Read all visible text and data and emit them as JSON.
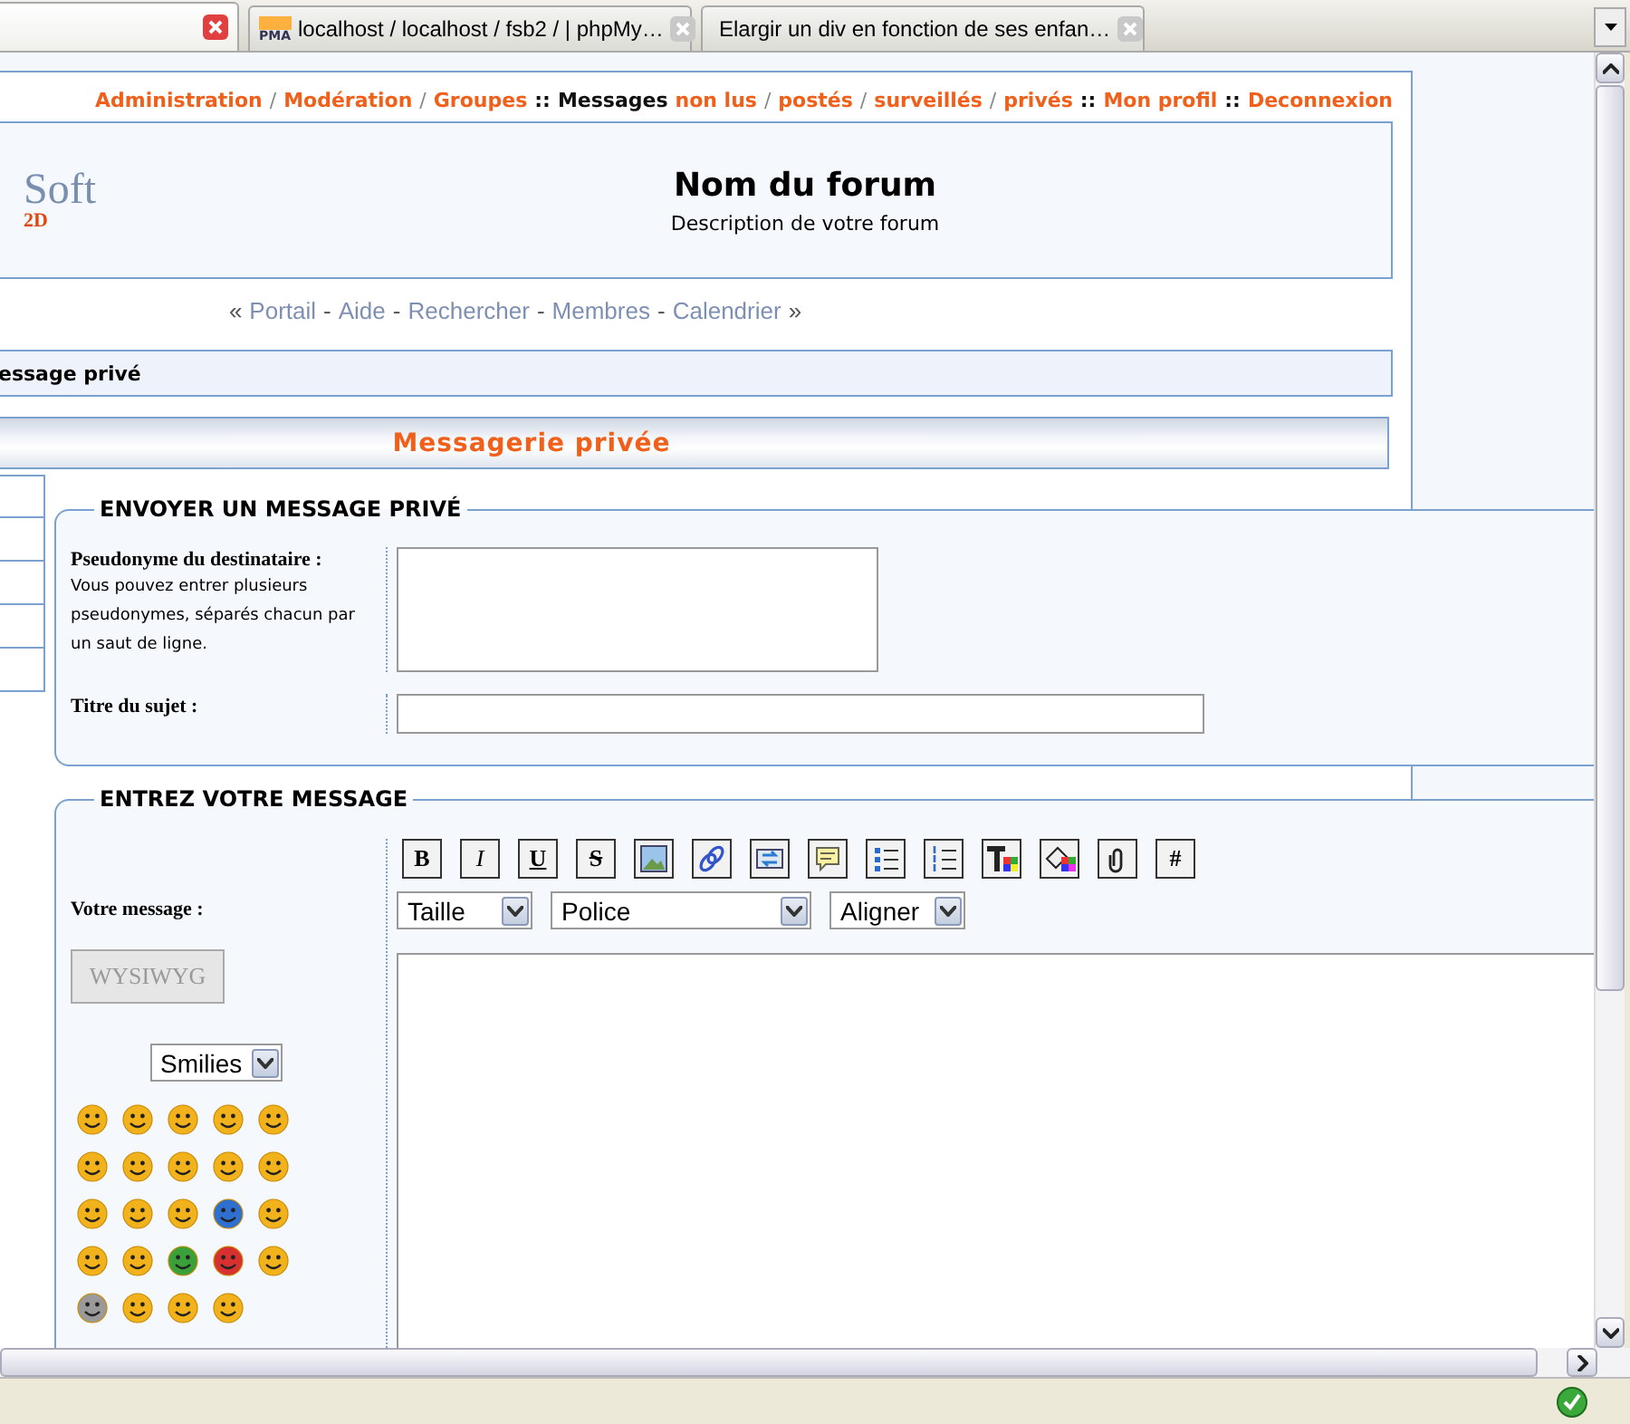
{
  "browser_tabs": [
    {
      "selected": true
    },
    {
      "title": "localhost / localhost / fsb2  /  | phpMy…",
      "kind": "pma",
      "icon_text": "PMA",
      "selected": false
    },
    {
      "title": "Elargir un div en fonction de ses enfan…",
      "kind": "sun",
      "selected": false
    }
  ],
  "top_links": [
    {
      "text": "Administration",
      "kind": "link"
    },
    {
      "text": "/",
      "kind": "sep"
    },
    {
      "text": "Modération",
      "kind": "link"
    },
    {
      "text": "/",
      "kind": "sep"
    },
    {
      "text": "Groupes",
      "kind": "link"
    },
    {
      "text": "::",
      "kind": "label"
    },
    {
      "text": "Messages",
      "kind": "label"
    },
    {
      "text": "non lus",
      "kind": "link"
    },
    {
      "text": "/",
      "kind": "sep"
    },
    {
      "text": "postés",
      "kind": "link"
    },
    {
      "text": "/",
      "kind": "sep"
    },
    {
      "text": "surveillés",
      "kind": "link"
    },
    {
      "text": "/",
      "kind": "sep"
    },
    {
      "text": "privés",
      "kind": "link"
    },
    {
      "text": "::",
      "kind": "label"
    },
    {
      "text": "Mon profil",
      "kind": "link"
    },
    {
      "text": "::",
      "kind": "label"
    },
    {
      "text": "Deconnexion",
      "kind": "link"
    }
  ],
  "header": {
    "logo": "Soft",
    "logo_sub": "2D",
    "title": "Nom du forum",
    "description": "Description de votre forum"
  },
  "nav_links": [
    {
      "text": "«",
      "kind": "sep"
    },
    {
      "text": "Portail",
      "kind": "link"
    },
    {
      "text": "-",
      "kind": "sep"
    },
    {
      "text": "Aide",
      "kind": "link"
    },
    {
      "text": "-",
      "kind": "sep"
    },
    {
      "text": "Rechercher",
      "kind": "link"
    },
    {
      "text": "-",
      "kind": "sep"
    },
    {
      "text": "Membres",
      "kind": "link"
    },
    {
      "text": "-",
      "kind": "sep"
    },
    {
      "text": "Calendrier",
      "kind": "link"
    },
    {
      "text": "»",
      "kind": "sep"
    }
  ],
  "breadcrumb": "essage privé",
  "page_title": "Messagerie privée",
  "send_section": {
    "legend": "ENVOYER UN MESSAGE PRIVÉ",
    "recipient_label": "Pseudonyme du destinataire :",
    "recipient_help": "Vous pouvez entrer plusieurs pseudonymes, séparés chacun par un saut de ligne.",
    "subject_label": "Titre du sujet :"
  },
  "message_section": {
    "legend": "ENTREZ VOTRE MESSAGE",
    "message_label": "Votre message :",
    "wysiwyg_button": {
      "label": "WYSIWYG",
      "disabled": true
    },
    "smilies_select": "Smilies",
    "format_buttons": [
      {
        "kind": "bold",
        "label": "B"
      },
      {
        "kind": "italic",
        "label": "I"
      },
      {
        "kind": "underline",
        "label": "U"
      },
      {
        "kind": "strike",
        "label": "S"
      },
      {
        "kind": "image"
      },
      {
        "kind": "link"
      },
      {
        "kind": "swap"
      },
      {
        "kind": "quote"
      },
      {
        "kind": "bullets"
      },
      {
        "kind": "numbers"
      },
      {
        "kind": "text-color"
      },
      {
        "kind": "fill"
      },
      {
        "kind": "clip"
      },
      {
        "kind": "hash",
        "label": "#"
      }
    ],
    "selects": [
      {
        "value": "Taille",
        "kind": "small"
      },
      {
        "value": "Police",
        "kind": "wide"
      },
      {
        "value": "Aligner",
        "kind": "small"
      }
    ]
  }
}
